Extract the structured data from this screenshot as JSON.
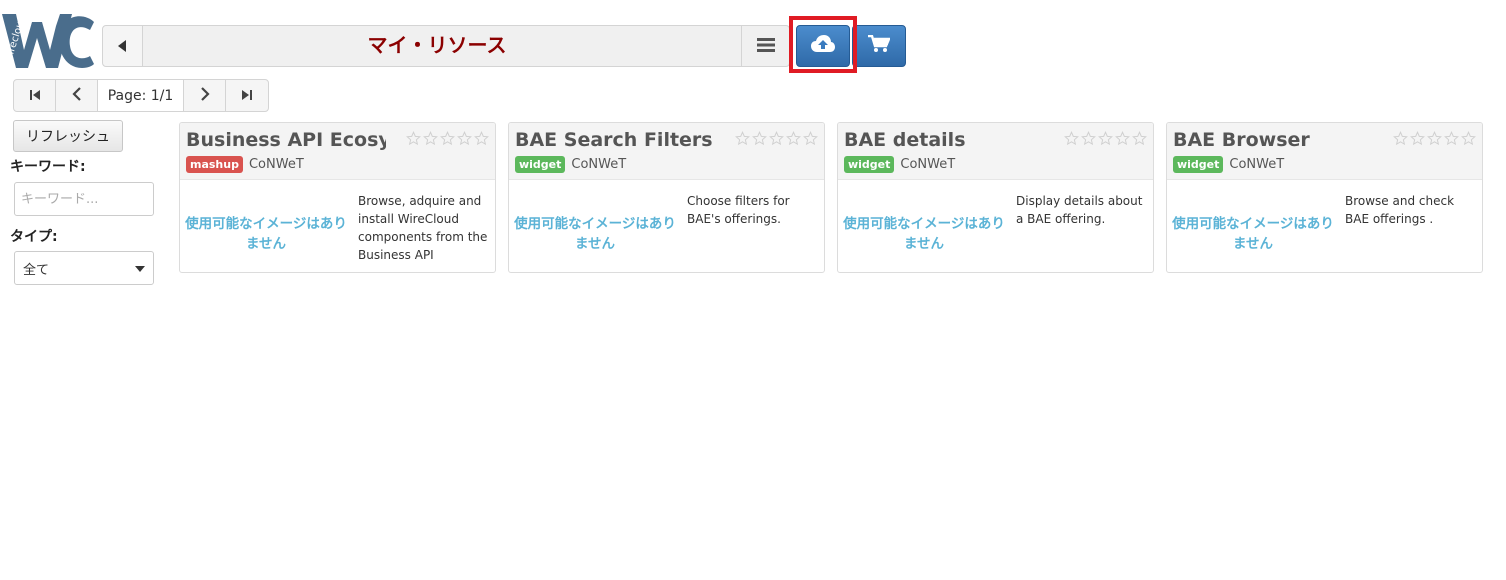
{
  "logo": {
    "text": "Wirecloud"
  },
  "header": {
    "title": "マイ・リソース",
    "back_icon": "caret-left-icon",
    "menu_icon": "hamburger-icon"
  },
  "actions": {
    "upload_icon": "cloud-upload-icon",
    "cart_icon": "shopping-cart-icon",
    "accent_color": "#3a7bbf",
    "highlight_color": "#e01b24"
  },
  "pager": {
    "label": "Page: 1/1"
  },
  "filters": {
    "refresh_label": "リフレッシュ",
    "keyword_label": "キーワード:",
    "keyword_placeholder": "キーワード...",
    "keyword_value": "",
    "type_label": "タイプ:",
    "type_selected": "全て"
  },
  "cards": [
    {
      "title": "Business API Ecosystem",
      "type": "mashup",
      "type_color": "#d9534f",
      "vendor": "CoNWeT",
      "no_image": "使用可能なイメージはありません",
      "description": "Browse, adquire and install WireCloud components from the Business API",
      "rating": 0
    },
    {
      "title": "BAE Search Filters",
      "type": "widget",
      "type_color": "#5cb85c",
      "vendor": "CoNWeT",
      "no_image": "使用可能なイメージはありません",
      "description": "Choose filters for BAE's offerings.",
      "rating": 0
    },
    {
      "title": "BAE details",
      "type": "widget",
      "type_color": "#5cb85c",
      "vendor": "CoNWeT",
      "no_image": "使用可能なイメージはありません",
      "description": "Display details about a BAE offering.",
      "rating": 0
    },
    {
      "title": "BAE Browser",
      "type": "widget",
      "type_color": "#5cb85c",
      "vendor": "CoNWeT",
      "no_image": "使用可能なイメージはありません",
      "description": "Browse and check BAE offerings .",
      "rating": 0
    }
  ]
}
